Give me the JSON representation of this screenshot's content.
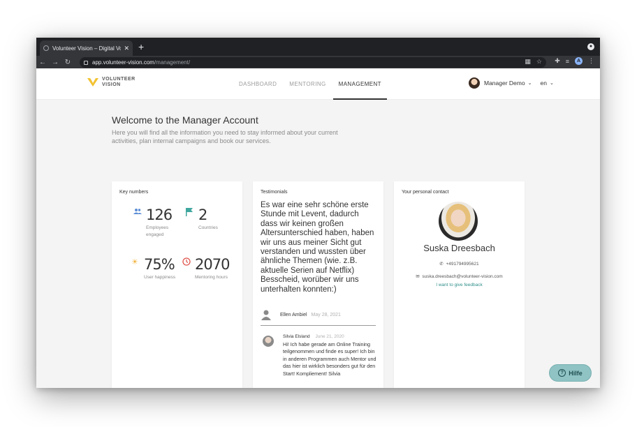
{
  "browser": {
    "tab_title": "Volunteer Vision – Digital Volun",
    "tab_close": "✕",
    "new_tab": "+",
    "url_host": "app.volunteer-vision.com",
    "url_path": "/management/",
    "profile_initial": "A"
  },
  "header": {
    "logo_line1": "VOLUNTEER",
    "logo_line2": "VISION",
    "nav": [
      {
        "label": "DASHBOARD",
        "active": false
      },
      {
        "label": "MENTORING",
        "active": false
      },
      {
        "label": "MANAGEMENT",
        "active": true
      }
    ],
    "user_name": "Manager Demo",
    "language": "en"
  },
  "welcome": {
    "title": "Welcome to the Manager Account",
    "subtitle": "Here you will find all the information you need to stay informed about your current activities, plan internal campaigns and book our services."
  },
  "key_numbers": {
    "title": "Key numbers",
    "items": [
      {
        "icon": "people-icon",
        "value": "126",
        "label": "Employees engaged",
        "color": "#5b8dd6"
      },
      {
        "icon": "flag-icon",
        "value": "2",
        "label": "Countries",
        "color": "#3fa79e"
      },
      {
        "icon": "sun-icon",
        "value": "75%",
        "label": "User happiness",
        "color": "#f0b23a"
      },
      {
        "icon": "clock-icon",
        "value": "2070",
        "label": "Mentoring hours",
        "color": "#e0564e"
      }
    ]
  },
  "testimonials": {
    "title": "Testimonials",
    "main_text": "Es war eine sehr schöne erste Stunde mit Levent, dadurch dass wir keinen großen Altersunterschied haben, haben wir uns aus meiner Sicht gut verstanden und wussten über ähnliche Themen (wie. z.B. aktuelle Serien auf Netflix) Besscheid, worüber wir uns unterhalten konnten:)",
    "main_author": "Ellen Ambiel",
    "main_date": "May 28, 2021",
    "second_author": "Silvia Elsland",
    "second_date": "June 21, 2020",
    "second_text": "Hi! Ich habe gerade am Online Training teilgenommen und finde es super! Ich bin in anderen Programmen auch Mentor und das hier ist wirklich besonders gut für den Start! Kompliement! Silvia"
  },
  "contact": {
    "title": "Your personal contact",
    "name": "Suska Dreesbach",
    "phone": "+491794995621",
    "email": "suska.dreesbach@volunteer-vision.com",
    "feedback_link": "I want to give feedback"
  },
  "help_button": "Hilfe"
}
